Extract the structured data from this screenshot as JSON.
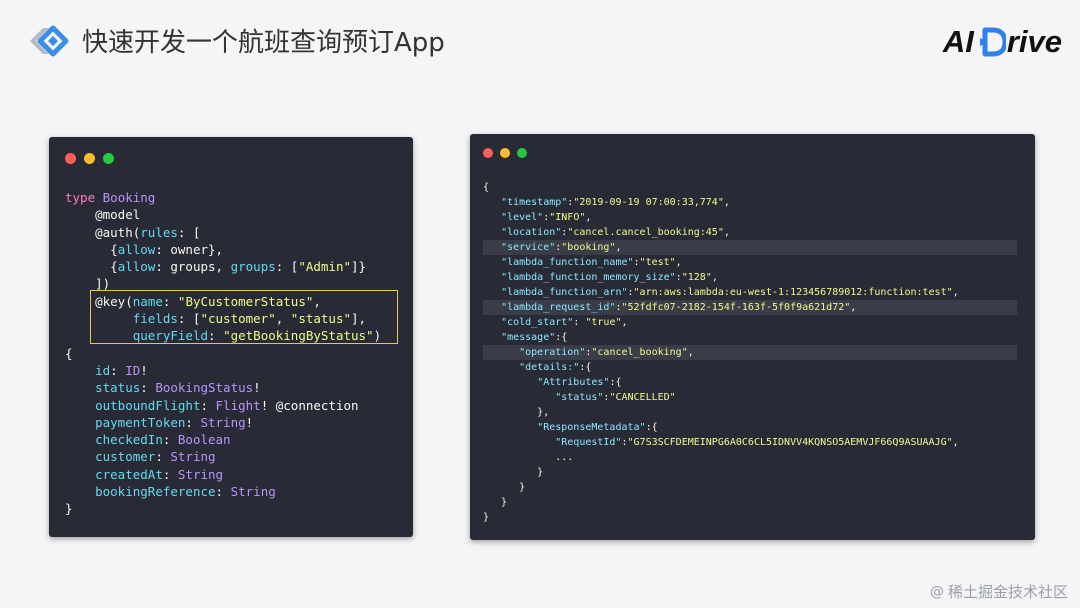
{
  "header": {
    "title": "快速开发一个航班查询预订App",
    "brand_left": "AI",
    "brand_right": "rive"
  },
  "left_editor": {
    "lines": [
      [
        [
          "kw",
          "type"
        ],
        [
          "punc",
          " "
        ],
        [
          "ty",
          "Booking"
        ]
      ],
      [
        [
          "punc",
          "    "
        ],
        [
          "fn",
          "@model"
        ]
      ],
      [
        [
          "punc",
          "    "
        ],
        [
          "fn",
          "@auth("
        ],
        [
          "prop",
          "rules"
        ],
        [
          "punc",
          ": ["
        ]
      ],
      [
        [
          "punc",
          "      {"
        ],
        [
          "prop",
          "allow"
        ],
        [
          "punc",
          ": owner},"
        ]
      ],
      [
        [
          "punc",
          "      {"
        ],
        [
          "prop",
          "allow"
        ],
        [
          "punc",
          ": groups, "
        ],
        [
          "prop",
          "groups"
        ],
        [
          "punc",
          ": ["
        ],
        [
          "str",
          "\"Admin\""
        ],
        [
          "punc",
          "]}"
        ]
      ],
      [
        [
          "punc",
          "    ])"
        ]
      ],
      [
        [
          "punc",
          "    "
        ],
        [
          "fn",
          "@key("
        ],
        [
          "prop",
          "name"
        ],
        [
          "punc",
          ": "
        ],
        [
          "str",
          "\"ByCustomerStatus\""
        ],
        [
          "punc",
          ","
        ]
      ],
      [
        [
          "punc",
          "         "
        ],
        [
          "prop",
          "fields"
        ],
        [
          "punc",
          ": ["
        ],
        [
          "str",
          "\"customer\""
        ],
        [
          "punc",
          ", "
        ],
        [
          "str",
          "\"status\""
        ],
        [
          "punc",
          "],"
        ]
      ],
      [
        [
          "punc",
          "         "
        ],
        [
          "prop",
          "queryField"
        ],
        [
          "punc",
          ": "
        ],
        [
          "str",
          "\"getBookingByStatus\""
        ],
        [
          "punc",
          ")"
        ]
      ],
      [
        [
          "punc",
          "{"
        ]
      ],
      [
        [
          "punc",
          "    "
        ],
        [
          "prop",
          "id"
        ],
        [
          "punc",
          ": "
        ],
        [
          "ty",
          "ID"
        ],
        [
          "punc",
          "!"
        ]
      ],
      [
        [
          "punc",
          "    "
        ],
        [
          "prop",
          "status"
        ],
        [
          "punc",
          ": "
        ],
        [
          "ty",
          "BookingStatus"
        ],
        [
          "punc",
          "!"
        ]
      ],
      [
        [
          "punc",
          "    "
        ],
        [
          "prop",
          "outboundFlight"
        ],
        [
          "punc",
          ": "
        ],
        [
          "ty",
          "Flight"
        ],
        [
          "punc",
          "! @connection"
        ]
      ],
      [
        [
          "punc",
          "    "
        ],
        [
          "prop",
          "paymentToken"
        ],
        [
          "punc",
          ": "
        ],
        [
          "ty",
          "String"
        ],
        [
          "punc",
          "!"
        ]
      ],
      [
        [
          "punc",
          "    "
        ],
        [
          "prop",
          "checkedIn"
        ],
        [
          "punc",
          ": "
        ],
        [
          "ty",
          "Boolean"
        ]
      ],
      [
        [
          "punc",
          "    "
        ],
        [
          "prop",
          "customer"
        ],
        [
          "punc",
          ": "
        ],
        [
          "ty",
          "String"
        ]
      ],
      [
        [
          "punc",
          "    "
        ],
        [
          "prop",
          "createdAt"
        ],
        [
          "punc",
          ": "
        ],
        [
          "ty",
          "String"
        ]
      ],
      [
        [
          "punc",
          "    "
        ],
        [
          "prop",
          "bookingReference"
        ],
        [
          "punc",
          ": "
        ],
        [
          "ty",
          "String"
        ]
      ],
      [
        [
          "punc",
          "}"
        ]
      ]
    ]
  },
  "right_editor": {
    "lines": [
      {
        "hl": false,
        "t": [
          [
            "punc",
            "{"
          ]
        ]
      },
      {
        "hl": false,
        "t": [
          [
            "punc",
            "   "
          ],
          [
            "rkey",
            "\"timestamp\""
          ],
          [
            "punc",
            ":"
          ],
          [
            "rstr",
            "\"2019-09-19 07:00:33,774\""
          ],
          [
            "punc",
            ","
          ]
        ]
      },
      {
        "hl": false,
        "t": [
          [
            "punc",
            "   "
          ],
          [
            "rkey",
            "\"level\""
          ],
          [
            "punc",
            ":"
          ],
          [
            "rstr",
            "\"INFO\""
          ],
          [
            "punc",
            ","
          ]
        ]
      },
      {
        "hl": false,
        "t": [
          [
            "punc",
            "   "
          ],
          [
            "rkey",
            "\"location\""
          ],
          [
            "punc",
            ":"
          ],
          [
            "rstr",
            "\"cancel.cancel_booking:45\""
          ],
          [
            "punc",
            ","
          ]
        ]
      },
      {
        "hl": true,
        "t": [
          [
            "punc",
            "   "
          ],
          [
            "rkey",
            "\"service\""
          ],
          [
            "punc",
            ":"
          ],
          [
            "rstr",
            "\"booking\""
          ],
          [
            "punc",
            ","
          ]
        ]
      },
      {
        "hl": false,
        "t": [
          [
            "punc",
            "   "
          ],
          [
            "rkey",
            "\"lambda_function_name\""
          ],
          [
            "punc",
            ":"
          ],
          [
            "rstr",
            "\"test\""
          ],
          [
            "punc",
            ","
          ]
        ]
      },
      {
        "hl": false,
        "t": [
          [
            "punc",
            "   "
          ],
          [
            "rkey",
            "\"lambda_function_memory_size\""
          ],
          [
            "punc",
            ":"
          ],
          [
            "rstr",
            "\"128\""
          ],
          [
            "punc",
            ","
          ]
        ]
      },
      {
        "hl": false,
        "t": [
          [
            "punc",
            "   "
          ],
          [
            "rkey",
            "\"lambda_function_arn\""
          ],
          [
            "punc",
            ":"
          ],
          [
            "rstr",
            "\"arn:aws:lambda:eu-west-1:123456789012:function:test\""
          ],
          [
            "punc",
            ","
          ]
        ]
      },
      {
        "hl": true,
        "t": [
          [
            "punc",
            "   "
          ],
          [
            "rkey",
            "\"lambda_request_id\""
          ],
          [
            "punc",
            ":"
          ],
          [
            "rstr",
            "\"52fdfc07-2182-154f-163f-5f0f9a621d72\""
          ],
          [
            "punc",
            ","
          ]
        ]
      },
      {
        "hl": false,
        "t": [
          [
            "punc",
            "   "
          ],
          [
            "rkey",
            "\"cold_start\""
          ],
          [
            "punc",
            ": "
          ],
          [
            "rstr",
            "\"true\""
          ],
          [
            "punc",
            ","
          ]
        ]
      },
      {
        "hl": false,
        "t": [
          [
            "punc",
            "   "
          ],
          [
            "rkey",
            "\"message\""
          ],
          [
            "punc",
            ":{"
          ]
        ]
      },
      {
        "hl": true,
        "t": [
          [
            "punc",
            "      "
          ],
          [
            "rkey",
            "\"operation\""
          ],
          [
            "punc",
            ":"
          ],
          [
            "rstr",
            "\"cancel_booking\""
          ],
          [
            "punc",
            ","
          ]
        ]
      },
      {
        "hl": false,
        "t": [
          [
            "punc",
            "      "
          ],
          [
            "rkey",
            "\"details:\""
          ],
          [
            "punc",
            ":{"
          ]
        ]
      },
      {
        "hl": false,
        "t": [
          [
            "punc",
            "         "
          ],
          [
            "rkey",
            "\"Attributes\""
          ],
          [
            "punc",
            ":{"
          ]
        ]
      },
      {
        "hl": false,
        "t": [
          [
            "punc",
            "            "
          ],
          [
            "rkey",
            "\"status\""
          ],
          [
            "punc",
            ":"
          ],
          [
            "rstr",
            "\"CANCELLED\""
          ]
        ]
      },
      {
        "hl": false,
        "t": [
          [
            "punc",
            "         },"
          ]
        ]
      },
      {
        "hl": false,
        "t": [
          [
            "punc",
            "         "
          ],
          [
            "rkey",
            "\"ResponseMetadata\""
          ],
          [
            "punc",
            ":{"
          ]
        ]
      },
      {
        "hl": false,
        "t": [
          [
            "punc",
            "            "
          ],
          [
            "rkey",
            "\"RequestId\""
          ],
          [
            "punc",
            ":"
          ],
          [
            "rstr",
            "\"G7S3SCFDEMEINPG6A0C6CL5IDNVV4KQNSO5AEMVJF66Q9ASUAAJG\""
          ],
          [
            "punc",
            ","
          ]
        ]
      },
      {
        "hl": false,
        "t": [
          [
            "punc",
            "            ..."
          ]
        ]
      },
      {
        "hl": false,
        "t": [
          [
            "punc",
            "         }"
          ]
        ]
      },
      {
        "hl": false,
        "t": [
          [
            "punc",
            "      }"
          ]
        ]
      },
      {
        "hl": false,
        "t": [
          [
            "punc",
            "   }"
          ]
        ]
      },
      {
        "hl": false,
        "t": [
          [
            "punc",
            "}"
          ]
        ]
      }
    ]
  },
  "watermark": {
    "symbol": "@",
    "text": "稀土掘金技术社区"
  }
}
